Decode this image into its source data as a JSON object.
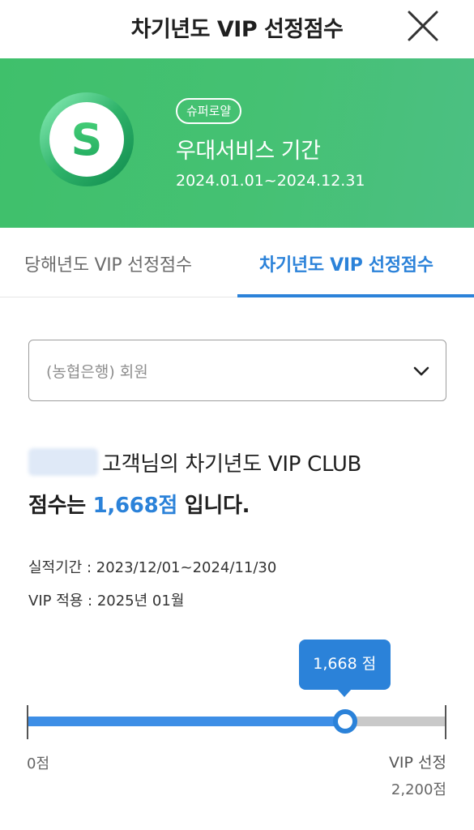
{
  "header": {
    "title": "차기년도  VIP 선정점수",
    "close_icon": "close-icon"
  },
  "banner": {
    "logo_letter": "S",
    "tier_badge": "슈퍼로얄",
    "title": "우대서비스 기간",
    "period": "2024.01.01~2024.12.31",
    "bg_color": "#43c071"
  },
  "tabs": [
    {
      "label": "당해년도 VIP 선정점수",
      "active": false
    },
    {
      "label": "차기년도 VIP 선정점수",
      "active": true
    }
  ],
  "member_select": {
    "value": "(농협은행) 회원"
  },
  "summary": {
    "line1": "고객님의 차기년도 VIP CLUB",
    "line2_prefix": "점수는 ",
    "score": "1,668점",
    "line2_suffix": " 입니다."
  },
  "info": {
    "period": "실적기간 : 2023/12/01~2024/11/30",
    "apply": "VIP 적용 : 2025년 01월"
  },
  "progress": {
    "score_value": 1668,
    "max_value": 2200,
    "tooltip": "1,668 점",
    "min_label": "0점",
    "max_label": "VIP 선정",
    "max_value_label": "2,200점",
    "accent_color": "#2b82d9"
  }
}
